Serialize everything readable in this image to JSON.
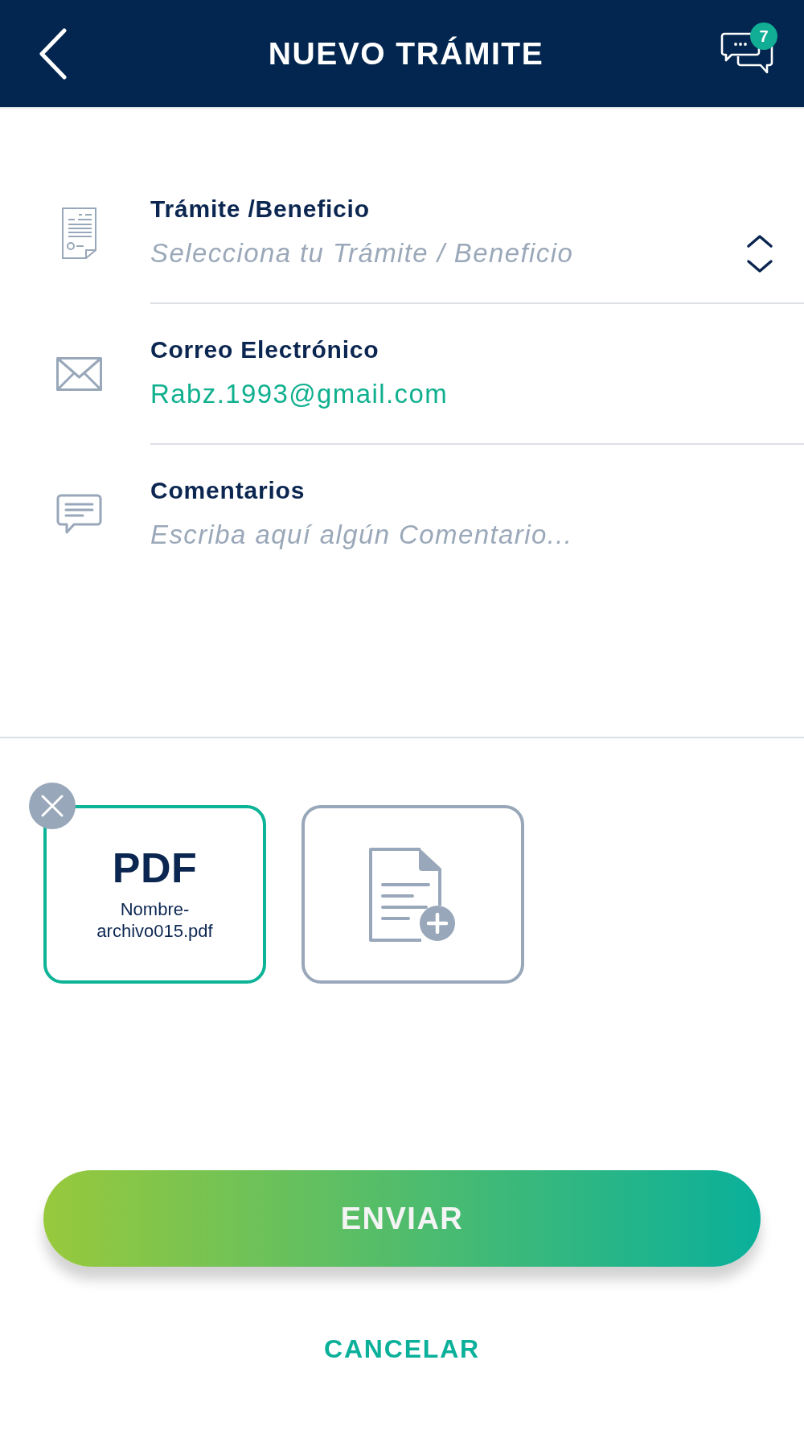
{
  "header": {
    "title": "NUEVO TRÁMITE",
    "messages_badge": "7"
  },
  "form": {
    "fields": [
      {
        "kind": "select",
        "label": "Trámite /Beneficio",
        "placeholder": "Selecciona tu Trámite / Beneficio"
      },
      {
        "kind": "email",
        "label": "Correo Electrónico",
        "value": "Rabz.1993@gmail.com"
      },
      {
        "kind": "textarea",
        "label": "Comentarios",
        "placeholder": "Escriba aquí algún Comentario..."
      }
    ]
  },
  "attachments": [
    {
      "kind": "file",
      "type_label": "PDF",
      "filename": "Nombre-archivo015.pdf"
    },
    {
      "kind": "add"
    }
  ],
  "actions": {
    "submit": "ENVIAR",
    "cancel": "CANCELAR"
  }
}
